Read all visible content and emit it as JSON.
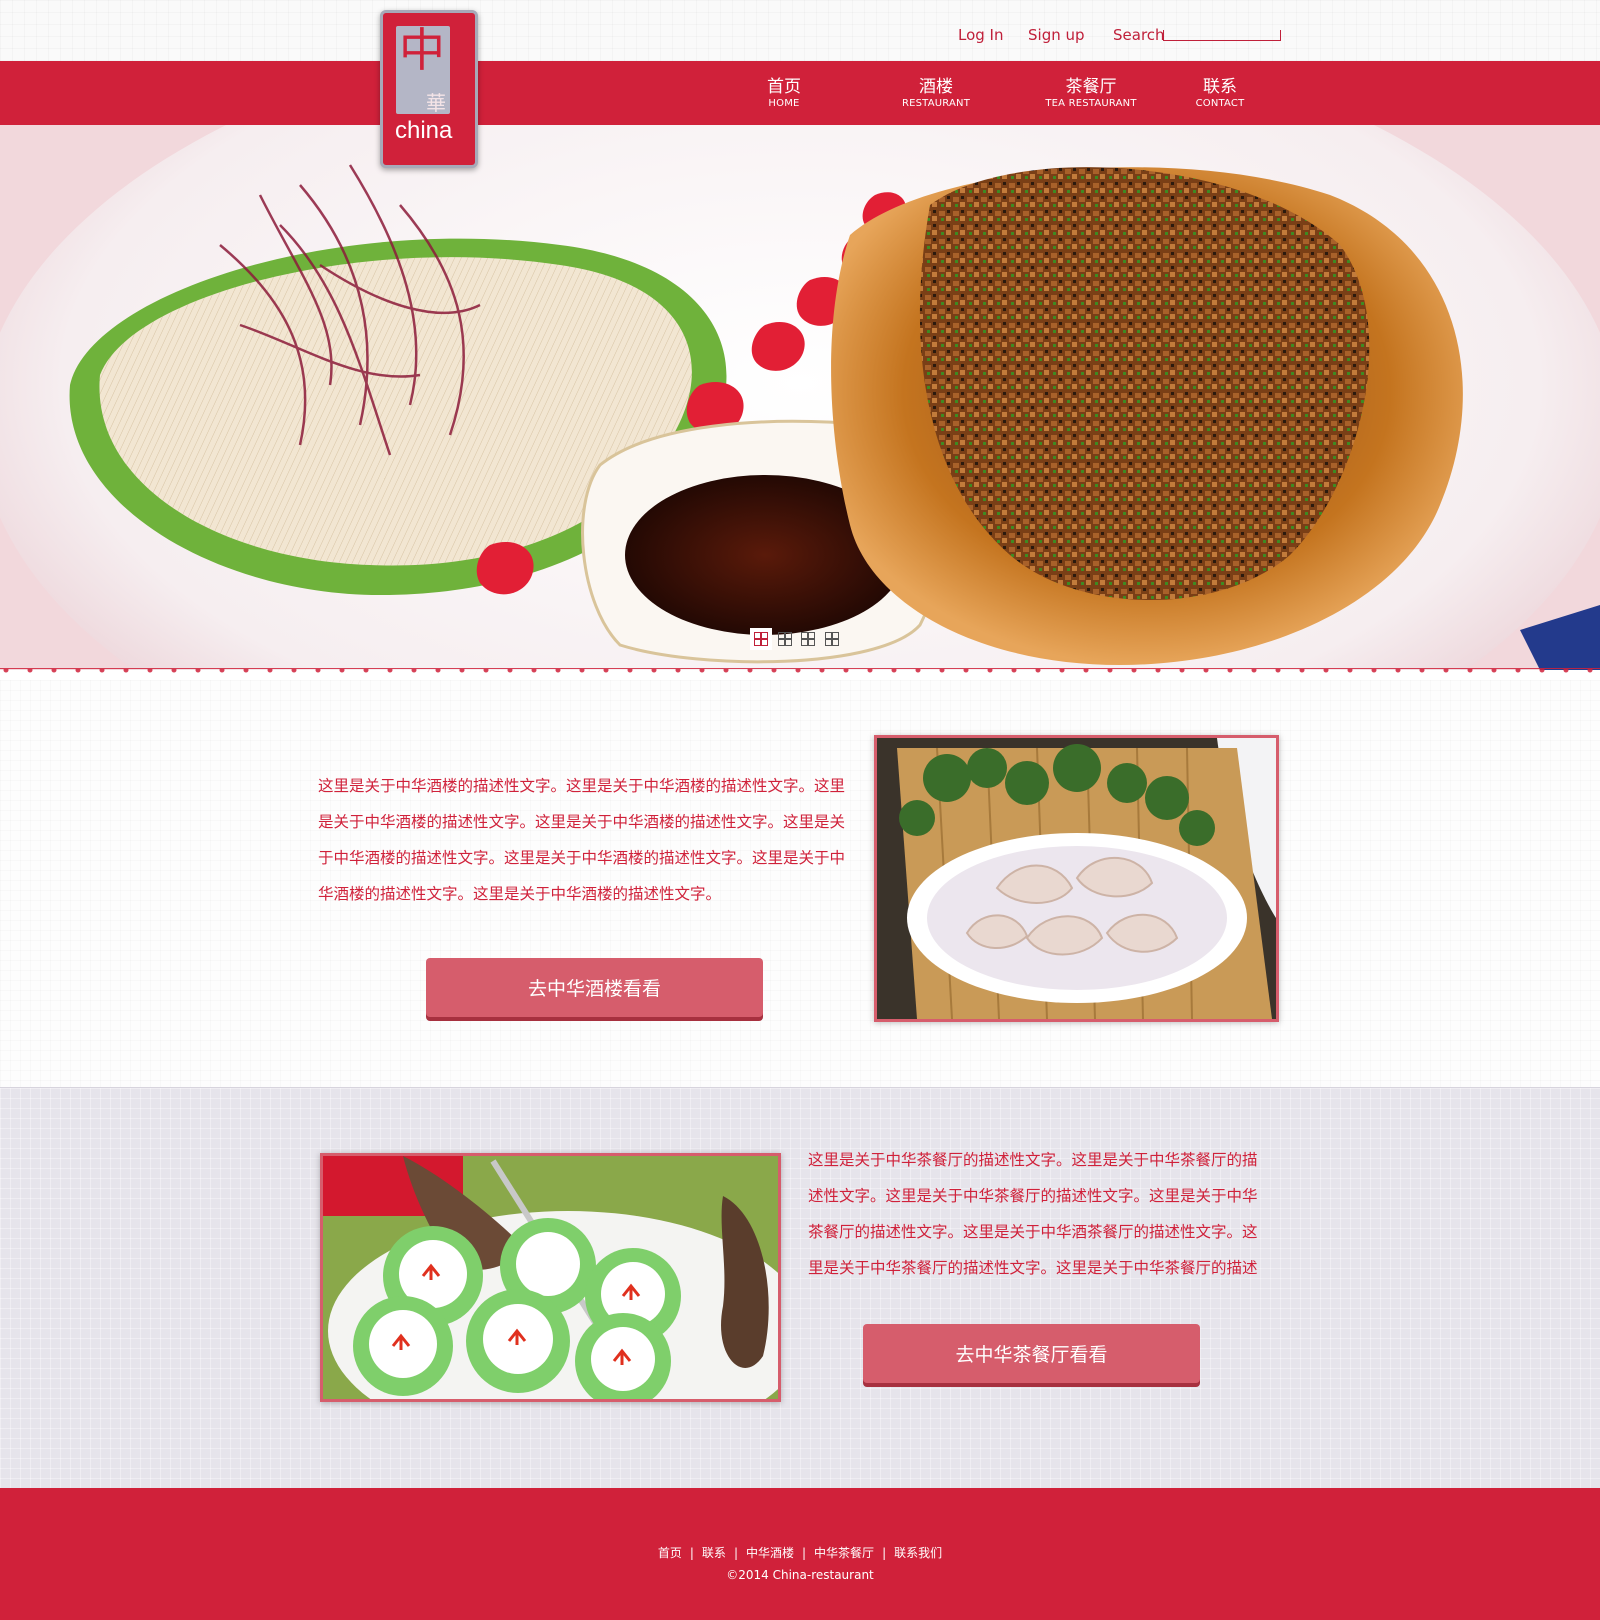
{
  "header": {
    "login_label": "Log In",
    "signup_label": "Sign up",
    "search_label": "Search",
    "search_value": ""
  },
  "logo": {
    "glyph": "中",
    "hua": "華",
    "text": "china"
  },
  "nav": {
    "items": [
      {
        "zh": "首页",
        "en": "HOME"
      },
      {
        "zh": "酒楼",
        "en": "RESTAURANT"
      },
      {
        "zh": "茶餐厅",
        "en": "TEA RESTAURANT"
      },
      {
        "zh": "联系",
        "en": "CONTACT"
      }
    ]
  },
  "hero": {
    "slides_count": 4,
    "active_slide": 1
  },
  "restaurant": {
    "description": "这里是关于中华酒楼的描述性文字。这里是关于中华酒楼的描述性文字。这里是关于中华酒楼的描述性文字。这里是关于中华酒楼的描述性文字。这里是关于中华酒楼的描述性文字。这里是关于中华酒楼的描述性文字。这里是关于中华酒楼的描述性文字。这里是关于中华酒楼的描述性文字。",
    "button_label": "去中华酒楼看看"
  },
  "tea_restaurant": {
    "description": "这里是关于中华茶餐厅的描述性文字。这里是关于中华茶餐厅的描述性文字。这里是关于中华茶餐厅的描述性文字。这里是关于中华茶餐厅的描述性文字。这里是关于中华酒茶餐厅的描述性文字。这里是关于中华茶餐厅的描述性文字。这里是关于中华茶餐厅的描述",
    "button_label": "去中华茶餐厅看看"
  },
  "footer": {
    "links": [
      "首页",
      "联系",
      "中华酒楼",
      "中华茶餐厅",
      "联系我们"
    ],
    "separator": "|",
    "copyright": "©2014 China-restaurant"
  },
  "colors": {
    "brand_red": "#d0213a",
    "button_pink": "#d65d6c",
    "section_gray": "#e6e4eb"
  },
  "icons": [
    "logo-mark",
    "slide-indicator-icon"
  ]
}
